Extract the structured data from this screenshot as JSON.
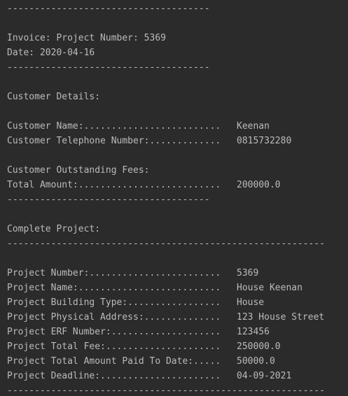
{
  "separator_short": "-------------------------------------",
  "separator_long": "----------------------------------------------------------",
  "invoice": {
    "title": "Invoice: Project Number: 5369",
    "date": "Date: 2020-04-16"
  },
  "customer": {
    "heading": "Customer Details:",
    "name_label": "Customer Name:.........................",
    "name_value": "Keenan",
    "phone_label": "Customer Telephone Number:.............",
    "phone_value": "0815732280"
  },
  "fees": {
    "heading": "Customer Outstanding Fees:",
    "total_label": "Total Amount:..........................",
    "total_value": "200000.0"
  },
  "project": {
    "heading": "Complete Project:",
    "rows": [
      {
        "label": "Project Number:........................",
        "value": "5369"
      },
      {
        "label": "Project Name:..........................",
        "value": "House Keenan"
      },
      {
        "label": "Project Building Type:.................",
        "value": "House"
      },
      {
        "label": "Project Physical Address:..............",
        "value": "123 House Street"
      },
      {
        "label": "Project ERF Number:....................",
        "value": "123456"
      },
      {
        "label": "Project Total Fee:.....................",
        "value": "250000.0"
      },
      {
        "label": "Project Total Amount Paid To Date:.....",
        "value": "50000.0"
      },
      {
        "label": "Project Deadline:......................",
        "value": "04-09-2021"
      }
    ]
  }
}
